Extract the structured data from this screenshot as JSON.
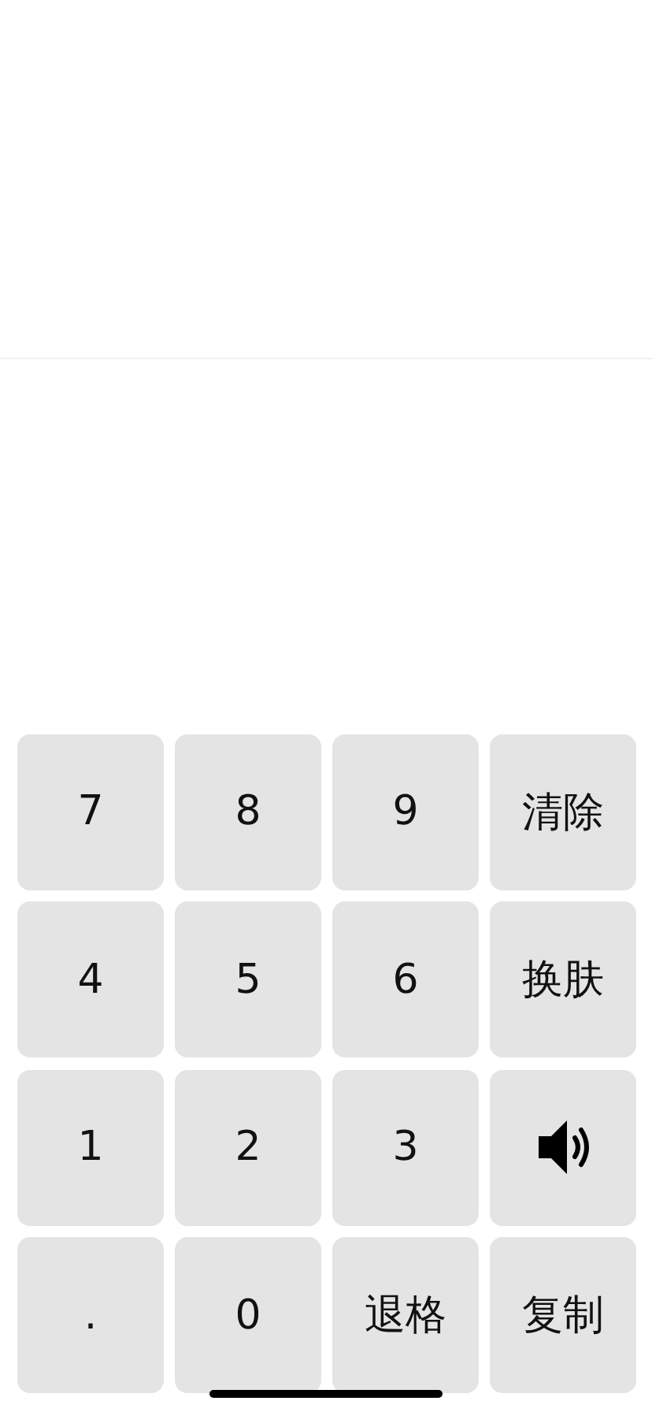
{
  "keys": [
    {
      "kind": "text",
      "label": "7"
    },
    {
      "kind": "text",
      "label": "8"
    },
    {
      "kind": "text",
      "label": "9"
    },
    {
      "kind": "text",
      "label": "清除"
    },
    {
      "kind": "text",
      "label": "4"
    },
    {
      "kind": "text",
      "label": "5"
    },
    {
      "kind": "text",
      "label": "6"
    },
    {
      "kind": "text",
      "label": "换肤"
    },
    {
      "kind": "text",
      "label": "1"
    },
    {
      "kind": "text",
      "label": "2"
    },
    {
      "kind": "text",
      "label": "3"
    },
    {
      "kind": "speaker"
    },
    {
      "kind": "text",
      "label": "."
    },
    {
      "kind": "text",
      "label": "0"
    },
    {
      "kind": "text",
      "label": "退格"
    },
    {
      "kind": "text",
      "label": "复制"
    }
  ]
}
